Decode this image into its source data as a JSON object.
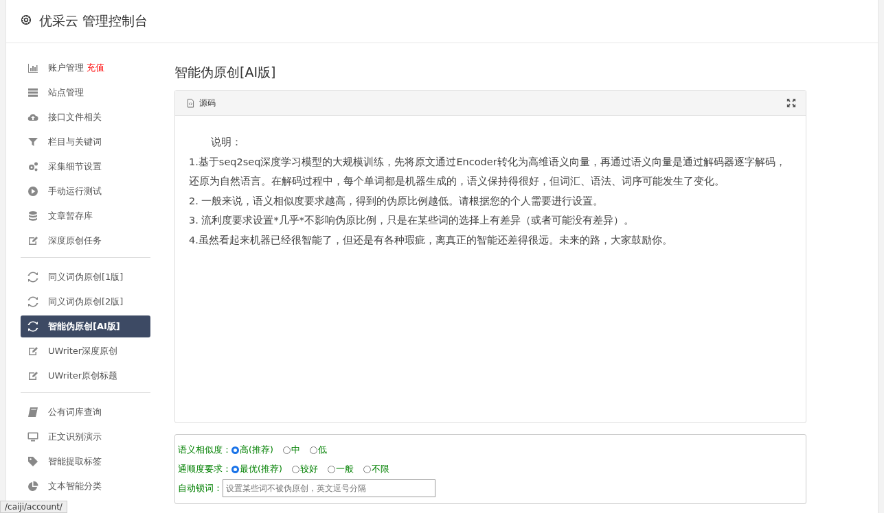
{
  "header": {
    "title": "优采云 管理控制台"
  },
  "sidebar": {
    "groups": [
      {
        "items": [
          {
            "label": "账户管理",
            "badge": "充值",
            "selected": false
          },
          {
            "label": "站点管理",
            "selected": false
          },
          {
            "label": "接口文件相关",
            "selected": false
          },
          {
            "label": "栏目与关键词",
            "selected": false
          },
          {
            "label": "采集细节设置",
            "selected": false
          },
          {
            "label": "手动运行测试",
            "selected": false
          },
          {
            "label": "文章暂存库",
            "selected": false
          },
          {
            "label": "深度原创任务",
            "selected": false
          }
        ]
      },
      {
        "items": [
          {
            "label": "同义词伪原创[1版]",
            "selected": false
          },
          {
            "label": "同义词伪原创[2版]",
            "selected": false
          },
          {
            "label": "智能伪原创[AI版]",
            "selected": true
          },
          {
            "label": "UWriter深度原创",
            "selected": false
          },
          {
            "label": "UWriter原创标题",
            "selected": false
          }
        ]
      },
      {
        "items": [
          {
            "label": "公有词库查询",
            "selected": false
          },
          {
            "label": "正文识别演示",
            "selected": false
          },
          {
            "label": "智能提取标签",
            "selected": false
          },
          {
            "label": "文本智能分类",
            "selected": false
          }
        ]
      }
    ]
  },
  "main": {
    "title": "智能伪原创[AI版]",
    "editor": {
      "toolbar_label": "源码",
      "paragraphs": [
        "说明：",
        "1.基于seq2seq深度学习模型的大规模训练，先将原文通过Encoder转化为高维语义向量，再通过语义向量是通过解码器逐字解码，还原为自然语言。在解码过程中，每个单词都是机器生成的，语义保持得很好，但词汇、语法、词序可能发生了变化。",
        "2. 一般来说，语义相似度要求越高，得到的伪原比例越低。请根据您的个人需要进行设置。",
        "3. 流利度要求设置*几乎*不影响伪原比例，只是在某些词的选择上有差异（或者可能没有差异）。",
        "4.虽然看起来机器已经很智能了，但还是有各种瑕疵，离真正的智能还差得很远。未来的路，大家鼓励你。"
      ]
    },
    "options": [
      {
        "label": "语义相似度：",
        "choices": [
          {
            "label": "高(推荐)",
            "selected": true
          },
          {
            "label": "中",
            "selected": false
          },
          {
            "label": "低",
            "selected": false
          }
        ]
      },
      {
        "label": "通顺度要求：",
        "choices": [
          {
            "label": "最优(推荐)",
            "selected": true
          },
          {
            "label": "较好",
            "selected": false
          },
          {
            "label": "一般",
            "selected": false
          },
          {
            "label": "不限",
            "selected": false
          }
        ]
      }
    ],
    "lock_words": {
      "label": "自动锁词：",
      "placeholder": "设置某些词不被伪原创，英文逗号分隔"
    }
  },
  "status_bar": {
    "url": "/caiji/account/"
  }
}
